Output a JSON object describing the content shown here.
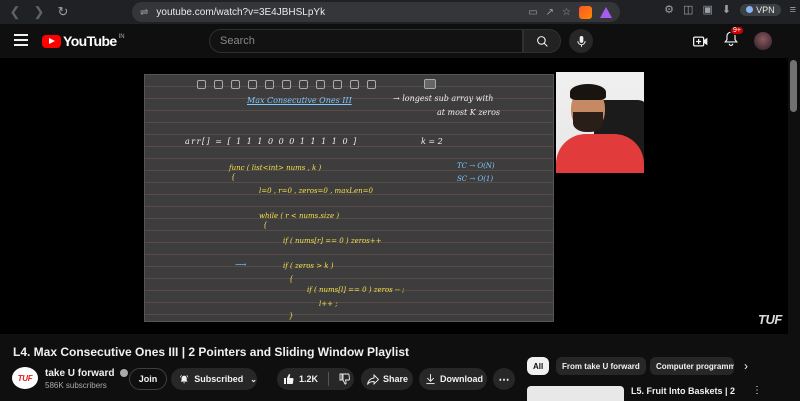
{
  "browser": {
    "url": "youtube.com/watch?v=3E4JBHSLpYk",
    "vpn_label": "VPN"
  },
  "header": {
    "logo_text": "YouTube",
    "logo_region": "IN",
    "search_placeholder": "Search",
    "notifications_badge": "9+"
  },
  "video": {
    "watermark": "TUF",
    "whiteboard": {
      "heading": "Max Consecutive Ones III",
      "note_line1": "→ longest sub array with",
      "note_line2": "at most K zeros",
      "array_line": "arr[] = [ 1 1 1 0 0 0 1 1 1 1 0 ]",
      "k_line": "k = 2",
      "func_line": "func ( list<int> nums , k )",
      "brace1": "{",
      "tc_line": "TC → O(N)",
      "sc_line": "SC → O(1)",
      "init_line": "l=0 , r=0 , zeros=0 , maxLen=0",
      "while_line": "while ( r < nums.size )",
      "brace2": "{",
      "if_line1": "if ( nums[r] == 0 )  zeros++",
      "if_line2": "if ( zeros > k )",
      "brace3": "{",
      "if_line3": "if ( nums[l] == 0 ) zeros -- ;",
      "l_line": "l++ ;",
      "brace4": "}"
    }
  },
  "details": {
    "title": "L4. Max Consecutive Ones III | 2 Pointers and Sliding Window Playlist",
    "channel_avatar_text": "TUF",
    "channel_name": "take U forward",
    "subscribers": "586K subscribers",
    "join_label": "Join",
    "subscribed_label": "Subscribed",
    "like_count": "1.2K",
    "share_label": "Share",
    "download_label": "Download"
  },
  "sidebar": {
    "chips": [
      "All",
      "From take U forward",
      "Computer programm"
    ],
    "recommendation_title": "L5. Fruit Into Baskets | 2"
  }
}
